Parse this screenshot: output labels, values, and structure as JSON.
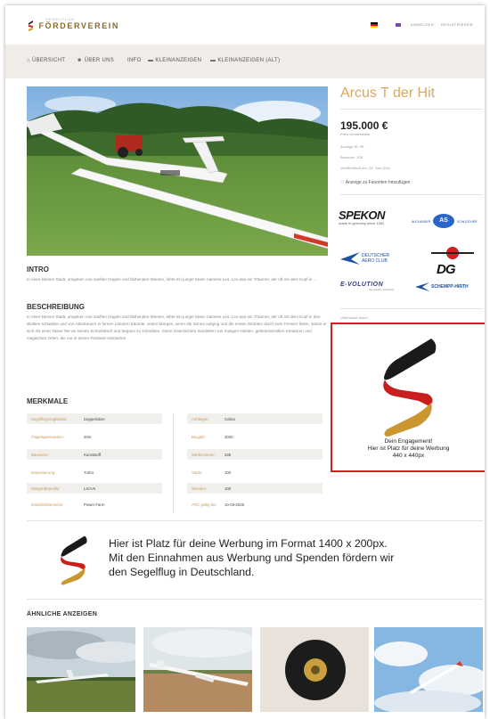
{
  "header": {
    "logo_text": "FÖRDERVEREIN",
    "logo_sub": "SEGELFLUG",
    "links": [
      "ANMELDEN",
      "REGISTRIEREN"
    ]
  },
  "nav": {
    "items": [
      {
        "icon": "home-icon",
        "label": "ÜBERSICHT"
      },
      {
        "icon": "users-icon",
        "label": "ÜBER UNS"
      },
      {
        "icon": "",
        "label": "INFO"
      },
      {
        "icon": "cart-icon",
        "label": "KLEINANZEIGEN"
      },
      {
        "icon": "cart-icon",
        "label": "KLEINANZEIGEN (ALT)"
      }
    ]
  },
  "listing": {
    "title": "Arcus T der Hit",
    "price": "195.000 €",
    "price_note": "Preis verhandelbar",
    "meta": [
      "Anzeige ID: 29",
      "Benutzer: 105",
      "Veröffentlicht am: 23. Juni 2024"
    ],
    "favorite_label": "Anzeige zu Favoriten hinzufügen"
  },
  "sponsors": {
    "spekon_name": "SPEKON",
    "spekon_tagline": "made in germany since 1982",
    "alexander_left": "ALEXANDER",
    "alexander_right": "SCHLEICHER",
    "daec_line1": "DEUTSCHER",
    "daec_line2": "AERO CLUB",
    "dg_name": "DG",
    "evolution_name": "E-VOLUTION",
    "evolution_sub": "the electric revolution",
    "schempp_name": "SCHEMPP-HIRTH",
    "label": "Unterstützt durch:"
  },
  "ad_box": {
    "line1": "Dein Engagement!",
    "line2": "Hier ist Platz für deine Werbung",
    "line3": "440 x 440px"
  },
  "intro": {
    "heading": "INTRO",
    "text": "In einer kleinen Stadt, umgeben von sanften Hügeln und blühenden Wiesen, lebte ein junger Mann namens Leo. Leo war ein Träumer, der oft mit dem Kopf in ..."
  },
  "description": {
    "heading": "BESCHREIBUNG",
    "text": "In einer kleinen Stadt, umgeben von sanften Hügeln und blühenden Wiesen, lebte ein junger Mann namens Leo. Leo war ein Träumer, der oft mit dem Kopf in den Wolken schwebte und von Abenteuern in fernen Ländern träumte. Jeden Morgen, wenn die Sonne aufging und die ersten Strahlen durch sein Fenster fielen, setzte er sich mit einer Tasse Tee an seinen Schreibtisch und begann zu schreiben. Seine Geschichten handelten von mutigen Helden, geheimnisvollen Kreaturen und magischen Orten, die nur in seiner Fantasie existierten."
  },
  "features": {
    "heading": "MERKMALE",
    "left": [
      {
        "key": "Segelflugzeugklasse:",
        "value": "Doppelsitzer"
      },
      {
        "key": "Flügelspannweiten:",
        "value": "20m"
      },
      {
        "key": "Bauweise:",
        "value": "Kunststoff"
      },
      {
        "key": "Motorisierung:",
        "value": "Turbo"
      },
      {
        "key": "Seitgeräteprofile:",
        "value": "LX/AAI"
      },
      {
        "key": "Zeitarfahrbereiche:",
        "value": "Power Farm"
      }
    ],
    "right": [
      {
        "key": "Anhänger:",
        "value": "Cobra"
      },
      {
        "key": "Baujahr:",
        "value": "2020"
      },
      {
        "key": "Werknummer:",
        "value": "235"
      },
      {
        "key": "Starts:",
        "value": "100"
      },
      {
        "key": "Stunden:",
        "value": "100"
      },
      {
        "key": "ARC gültig bis:",
        "value": "10-03-2025"
      }
    ]
  },
  "banner": {
    "line1": "Hier ist Platz für deine Werbung im Format 1400 x 200px.",
    "line2": "Mit den Einnahmen aus Werbung und Spenden fördern wir",
    "line3": "den Segelflug in Deutschland."
  },
  "similar": {
    "heading": "ÄHNLICHE ANZEIGEN"
  },
  "colors": {
    "accent": "#d8a860",
    "flag_black": "#1a1a1a",
    "flag_red": "#c81e1e",
    "flag_gold": "#c9962f",
    "ad_border": "#d42020"
  }
}
